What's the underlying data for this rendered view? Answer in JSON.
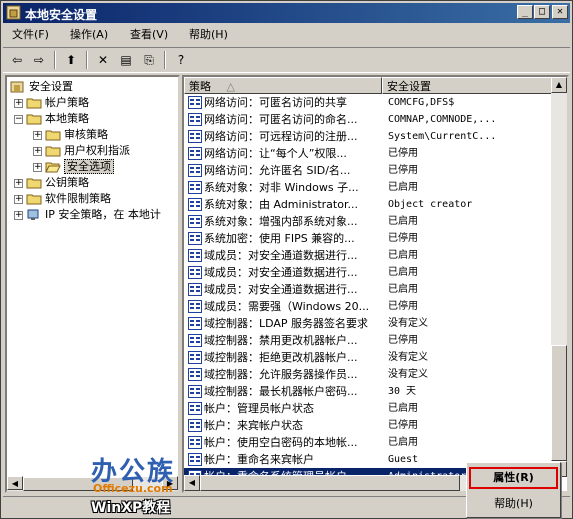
{
  "window": {
    "title": "本地安全设置"
  },
  "menu": [
    {
      "label": "文件(F)"
    },
    {
      "label": "操作(A)"
    },
    {
      "label": "查看(V)"
    },
    {
      "label": "帮助(H)"
    }
  ],
  "toolbar": [
    {
      "icon": "back-arrow-icon",
      "glyph": "⇦"
    },
    {
      "icon": "forward-arrow-icon",
      "glyph": "⇨"
    },
    {
      "icon": "up-folder-icon",
      "glyph": "⬆"
    },
    {
      "icon": "delete-icon",
      "glyph": "✕"
    },
    {
      "icon": "properties-icon",
      "glyph": "▤"
    },
    {
      "icon": "export-list-icon",
      "glyph": "⎘"
    },
    {
      "icon": "help-icon",
      "glyph": "?"
    }
  ],
  "tree": {
    "root": "安全设置",
    "nodes": [
      {
        "label": "帐户策略"
      },
      {
        "label": "本地策略"
      },
      {
        "label": "审核策略"
      },
      {
        "label": "用户权利指派"
      },
      {
        "label": "安全选项"
      },
      {
        "label": "公钥策略"
      },
      {
        "label": "软件限制策略"
      },
      {
        "label": "IP 安全策略，在 本地计"
      }
    ]
  },
  "list": {
    "columns": {
      "policy": "策略",
      "setting": "安全设置"
    },
    "rows": [
      {
        "policy": "网络访问：可匿名访问的共享",
        "setting": "COMCFG,DFS$"
      },
      {
        "policy": "网络访问：可匿名访问的命名...",
        "setting": "COMNAP,COMNODE,..."
      },
      {
        "policy": "网络访问：可远程访问的注册...",
        "setting": "System\\CurrentC..."
      },
      {
        "policy": "网络访问：让“每个人”权限...",
        "setting": "已停用"
      },
      {
        "policy": "网络访问：允许匿名 SID/名...",
        "setting": "已停用"
      },
      {
        "policy": "系统对象：对非 Windows 子...",
        "setting": "已启用"
      },
      {
        "policy": "系统对象：由 Administrator...",
        "setting": "Object creator"
      },
      {
        "policy": "系统对象：增强内部系统对象...",
        "setting": "已启用"
      },
      {
        "policy": "系统加密：使用 FIPS 兼容的...",
        "setting": "已停用"
      },
      {
        "policy": "域成员：对安全通道数据进行...",
        "setting": "已启用"
      },
      {
        "policy": "域成员：对安全通道数据进行...",
        "setting": "已启用"
      },
      {
        "policy": "域成员：对安全通道数据进行...",
        "setting": "已启用"
      },
      {
        "policy": "域成员：需要强（Windows 20...",
        "setting": "已停用"
      },
      {
        "policy": "域控制器：LDAP 服务器签名要求",
        "setting": "没有定义"
      },
      {
        "policy": "域控制器：禁用更改机器帐户...",
        "setting": "已停用"
      },
      {
        "policy": "域控制器：拒绝更改机器帐户...",
        "setting": "没有定义"
      },
      {
        "policy": "域控制器：允许服务器操作员...",
        "setting": "没有定义"
      },
      {
        "policy": "域控制器：最长机器帐户密码...",
        "setting": "30 天"
      },
      {
        "policy": "帐户：管理员帐户状态",
        "setting": "已启用"
      },
      {
        "policy": "帐户：来宾帐户状态",
        "setting": "已停用"
      },
      {
        "policy": "帐户：使用空白密码的本地帐...",
        "setting": "已启用"
      },
      {
        "policy": "帐户：重命名来宾帐户",
        "setting": "Guest"
      },
      {
        "policy": "帐户：重命名系统管理员帐户",
        "setting": "Administrator"
      }
    ]
  },
  "context_menu": {
    "properties": "属性(R)",
    "help": "帮助(H)"
  },
  "watermark": {
    "brand": "办公族",
    "site": "Officezu.com",
    "tag": "WinXP教程"
  }
}
